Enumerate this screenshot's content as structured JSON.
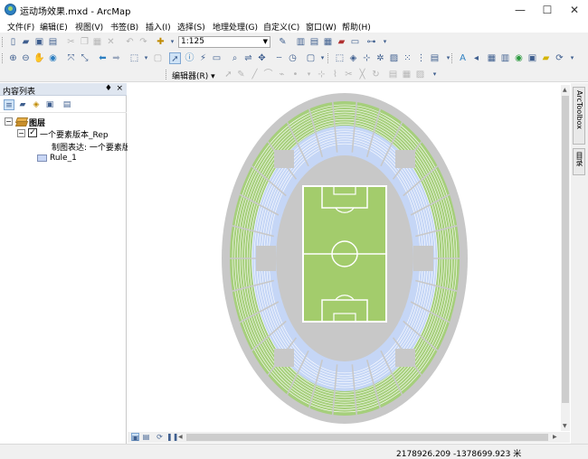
{
  "window": {
    "title": "运动场效果.mxd - ArcMap",
    "minimize": "—",
    "maximize": "☐",
    "close": "✕"
  },
  "menu": [
    "文件(F)",
    "编辑(E)",
    "视图(V)",
    "书签(B)",
    "插入(I)",
    "选择(S)",
    "地理处理(G)",
    "自定义(C)",
    "窗口(W)",
    "帮助(H)"
  ],
  "toolbar": {
    "scale": "1:125",
    "editor_label": "编辑器(R) ▾"
  },
  "toc": {
    "title": "内容列表",
    "pin": "♦",
    "close": "×",
    "root_label": "图层",
    "layer_label": "一个要素版本_Rep",
    "rep_label": "制图表达: 一个要素版",
    "rule_label": "Rule_1",
    "expander_open": "−",
    "check": "✓"
  },
  "dock": {
    "toolbox_tab": "ArcToolbox",
    "catalog_tab": "目录"
  },
  "status": {
    "coordinates": "2178926.209  -1378699.923 米"
  },
  "colors": {
    "stadium_fill": "#c8c8c8",
    "seat_green": "#a6cf7c",
    "seat_blue": "#c5d6f6",
    "pitch": "#a3cc6c",
    "lines": "#ffffff",
    "app_icon": "#2d7fc1"
  }
}
